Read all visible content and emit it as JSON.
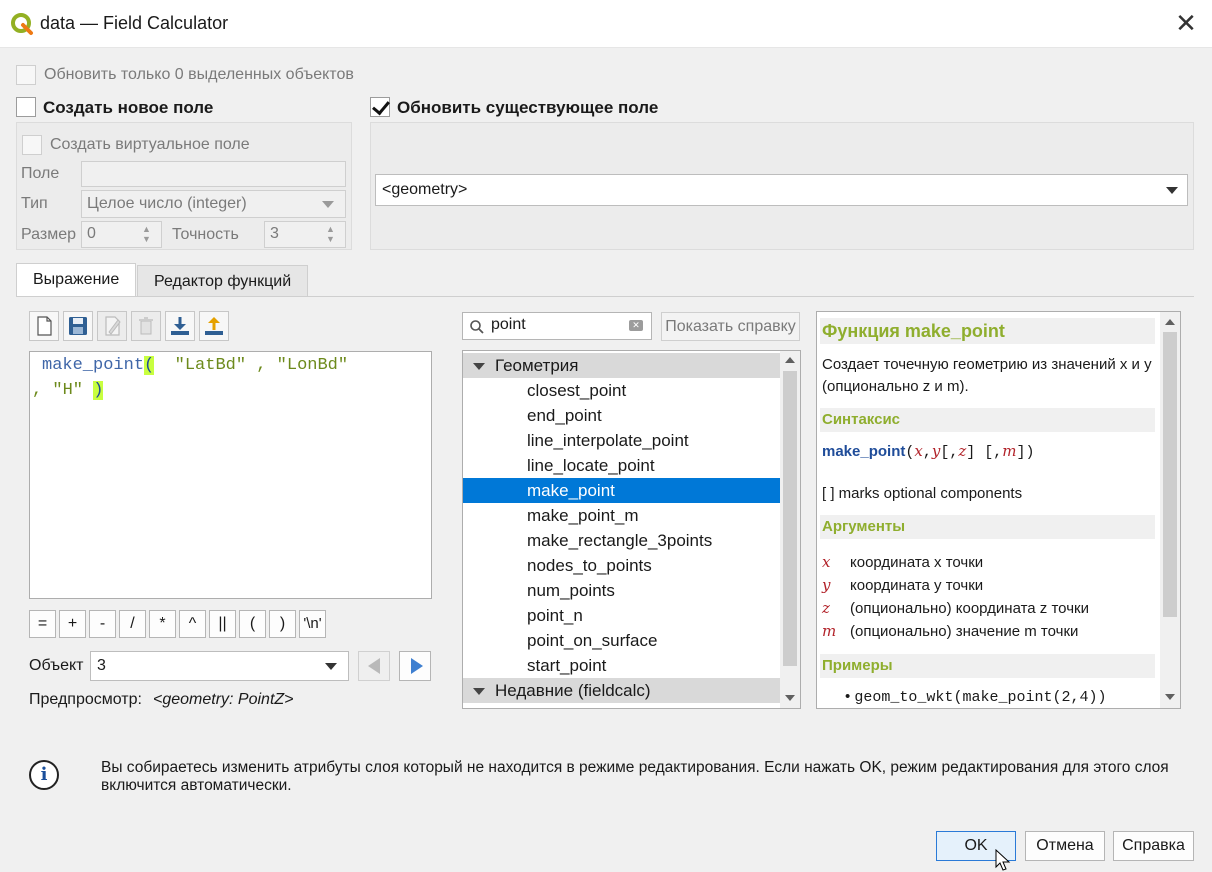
{
  "window": {
    "title": "data — Field Calculator"
  },
  "top": {
    "update_selected_label": "Обновить только 0 выделенных объектов",
    "create_new_field_label": "Создать новое поле",
    "update_existing_field_label": "Обновить существующее поле"
  },
  "new_field": {
    "virtual_label": "Создать виртуальное поле",
    "field_label": "Поле",
    "field_value": "",
    "type_label": "Тип",
    "type_value": "Целое число (integer)",
    "size_label": "Размер",
    "size_value": "0",
    "precision_label": "Точность",
    "precision_value": "3"
  },
  "existing_field": {
    "selected": "<geometry>"
  },
  "tabs": {
    "expression": "Выражение",
    "function_editor": "Редактор функций"
  },
  "toolbar_icons": [
    "new-file-icon",
    "save-icon",
    "edit-icon",
    "delete-icon",
    "load-icon",
    "export-icon"
  ],
  "expression": {
    "fn": "make_point",
    "open_paren": "(",
    "arg1": "\"LatBd\"",
    "comma1": ",",
    "arg2": "\"LonBd\"",
    "comma2": ",",
    "arg3": "\"H\"",
    "close_paren": ")"
  },
  "operators": [
    "=",
    "+",
    "-",
    "/",
    "*",
    "^",
    "||",
    "(",
    ")",
    "'\\n'"
  ],
  "feature": {
    "label": "Объект",
    "value": "3"
  },
  "preview": {
    "label": "Предпросмотр:",
    "value": "<geometry: PointZ>"
  },
  "search": {
    "value": "point",
    "show_help_label": "Показать справку"
  },
  "functions": {
    "group1": "Геометрия",
    "items": [
      "closest_point",
      "end_point",
      "line_interpolate_point",
      "line_locate_point",
      "make_point",
      "make_point_m",
      "make_rectangle_3points",
      "nodes_to_points",
      "num_points",
      "point_n",
      "point_on_surface",
      "start_point"
    ],
    "selected": "make_point",
    "group2": "Недавние (fieldcalc)"
  },
  "help": {
    "title": "Функция make_point",
    "description": "Создает точечную геометрию из значений x и y (опционально z и m).",
    "syntax_heading": "Синтаксис",
    "syntax_fn": "make_point",
    "syntax_p1": "(",
    "syntax_x": "x",
    "syntax_c1": ",",
    "syntax_y": "y",
    "syntax_p2": "[,",
    "syntax_z": "z",
    "syntax_p3": "] [,",
    "syntax_m": "m",
    "syntax_p4": "])",
    "optional_note": "[ ] marks optional components",
    "args_heading": "Аргументы",
    "args": [
      {
        "name": "x",
        "desc": "координата x точки"
      },
      {
        "name": "y",
        "desc": "координата y точки"
      },
      {
        "name": "z",
        "desc": "(опционально) координата z точки"
      },
      {
        "name": "m",
        "desc": "(опционально) значение m точки"
      }
    ],
    "examples_heading": "Примеры",
    "example1": "geom_to_wkt(make_point(2,4))"
  },
  "info_message": "Вы собираетесь изменить атрибуты слоя который не находится в режиме редактирования. Если нажать OK, режим редактирования для этого слоя включится автоматически.",
  "buttons": {
    "ok": "OK",
    "cancel": "Отмена",
    "help": "Справка"
  },
  "colors": {
    "accent": "#0078d7",
    "help_heading": "#8fae2e",
    "selection": "#0078d7",
    "highlight": "#c8ff3f"
  }
}
